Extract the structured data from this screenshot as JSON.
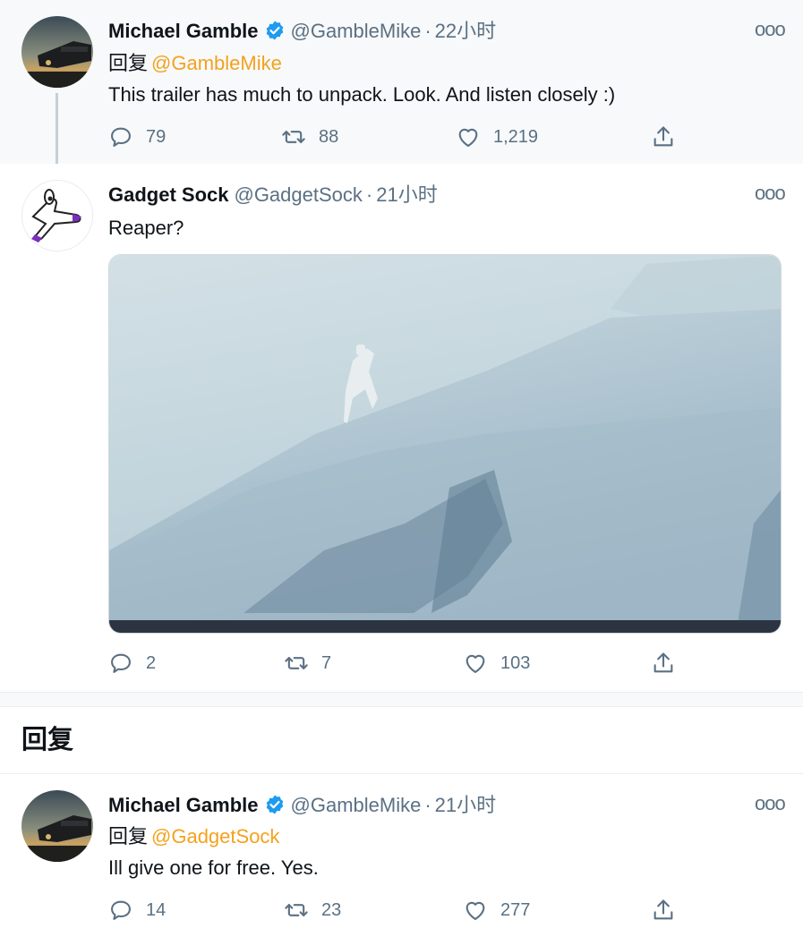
{
  "tweets": [
    {
      "name": "Michael Gamble",
      "handle": "@GambleMike",
      "dot": "·",
      "time": "22小时",
      "verified": true,
      "reply_prefix": "回复",
      "reply_to": "@GambleMike",
      "text": "This trailer has much to unpack. Look. And listen closely :)",
      "replies": "79",
      "retweets": "88",
      "likes": "1,219",
      "avatar_icon": "spaceship-avatar"
    },
    {
      "name": "Gadget Sock",
      "handle": "@GadgetSock",
      "dot": "·",
      "time": "21小时",
      "verified": false,
      "text": "Reaper?",
      "replies": "2",
      "retweets": "7",
      "likes": "103",
      "avatar_icon": "sock-puppet-avatar",
      "media": "snowy-slope-video-frame"
    },
    {
      "name": "Michael Gamble",
      "handle": "@GambleMike",
      "dot": "·",
      "time": "21小时",
      "verified": true,
      "reply_prefix": "回复",
      "reply_to": "@GadgetSock",
      "text": "Ill give one for free. Yes.",
      "replies": "14",
      "retweets": "23",
      "likes": "277",
      "avatar_icon": "spaceship-avatar"
    }
  ],
  "section": {
    "title": "回复"
  },
  "more_label": "ooo",
  "colors": {
    "mention": "#f4a21d",
    "verified": "#1d9bf0",
    "muted": "#5b7083"
  },
  "icons": [
    "more-icon",
    "reply-icon",
    "retweet-icon",
    "like-icon",
    "share-icon",
    "verified-icon"
  ]
}
